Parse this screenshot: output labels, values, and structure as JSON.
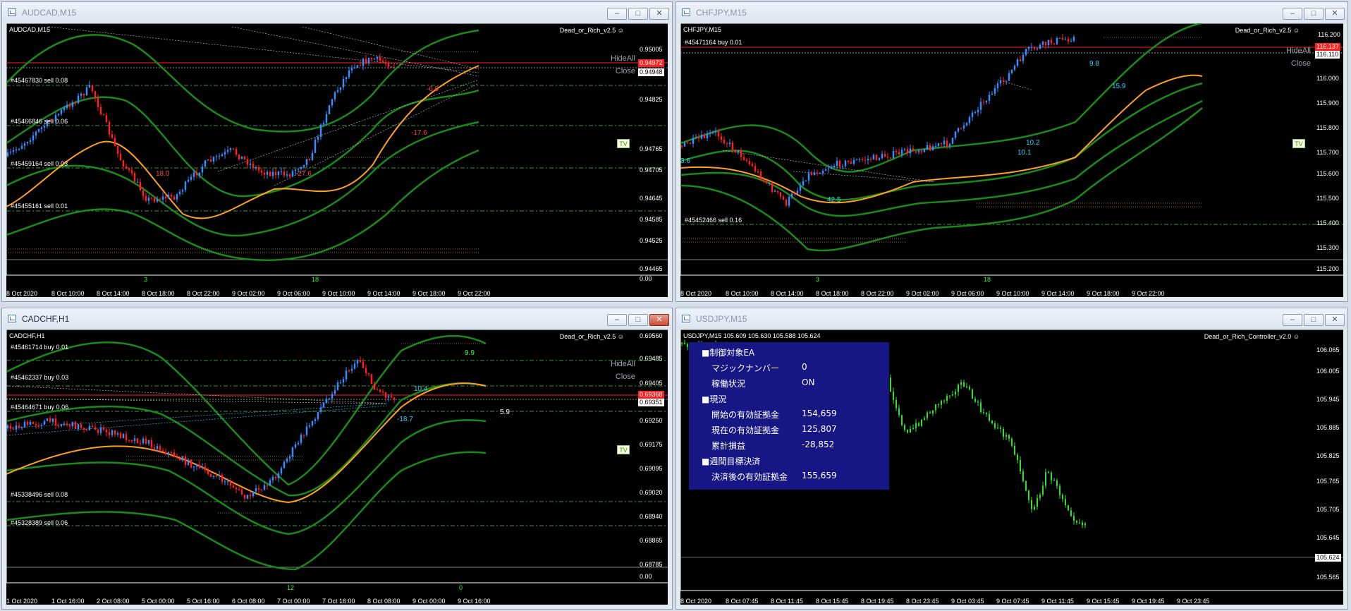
{
  "windows": {
    "w1": {
      "title": "AUDCAD,M15",
      "symbol": "AUDCAD,M15",
      "ea": "Dead_or_Rich_v2.5 ☺",
      "hideall": "HideAll",
      "close": "Close",
      "tv": "TV",
      "orders": [
        "#45467830 sell 0.08",
        "#45466846 sell 0.06",
        "#45459164 sell 0.03",
        "#45455161 sell 0.01"
      ],
      "price_ticks": [
        "0.95005",
        "0.94948",
        "0.94825",
        "0.94765",
        "0.94705",
        "0.94645",
        "0.94585",
        "0.94525",
        "0.94465",
        "0.00"
      ],
      "price_tag_red": "0.94972",
      "time_labels": [
        "8 Oct 2020",
        "8 Oct 10:00",
        "8 Oct 14:00",
        "8 Oct 18:00",
        "8 Oct 22:00",
        "9 Oct 02:00",
        "9 Oct 06:00",
        "9 Oct 10:00",
        "9 Oct 14:00",
        "9 Oct 18:00",
        "9 Oct 22:00"
      ],
      "sub_values": [
        "3",
        "18"
      ],
      "annotations": [
        "-6.9",
        "-17.6",
        "-27.6",
        "18.0"
      ]
    },
    "w2": {
      "title": "CHFJPY,M15",
      "symbol": "CHFJPY,M15",
      "ea": "Dead_or_Rich_v2.5 ☺",
      "hideall": "HideAll",
      "close": "Close",
      "tv": "TV",
      "orders": [
        "#45471164 buy 0.01",
        "#45452466 sell 0.16"
      ],
      "price_ticks": [
        "116.200",
        "116.110",
        "116.000",
        "115.900",
        "115.800",
        "115.700",
        "115.600",
        "115.500",
        "115.400",
        "115.300",
        "115.200"
      ],
      "price_tag_red": "116.137",
      "time_labels": [
        "8 Oct 2020",
        "8 Oct 10:00",
        "8 Oct 14:00",
        "8 Oct 18:00",
        "8 Oct 22:00",
        "9 Oct 02:00",
        "9 Oct 06:00",
        "9 Oct 10:00",
        "9 Oct 14:00",
        "9 Oct 18:00",
        "9 Oct 22:00"
      ],
      "sub_values": [
        "3",
        "18"
      ],
      "annotations": [
        "9.8",
        "15.9",
        "10.2",
        "10.1",
        "42.5",
        "3.6"
      ]
    },
    "w3": {
      "title": "CADCHF,H1",
      "symbol": "CADCHF,H1",
      "ea": "Dead_or_Rich_v2.5 ☺",
      "hideall": "HideAll",
      "close": "Close",
      "tv": "TV",
      "orders": [
        "#45461714 buy 0.01",
        "#45462337 buy 0.03",
        "#45464671 buy 0.06",
        "#45338496 sell 0.08",
        "#45328389 sell 0.06"
      ],
      "price_ticks": [
        "0.69560",
        "0.69485",
        "0.69405",
        "0.69351",
        "0.69250",
        "0.69175",
        "0.69095",
        "0.69020",
        "0.68940",
        "0.68865",
        "0.68785",
        "0.00"
      ],
      "price_tag_red": "0.69368",
      "time_labels": [
        "1 Oct 2020",
        "1 Oct 16:00",
        "2 Oct 08:00",
        "5 Oct 00:00",
        "5 Oct 16:00",
        "6 Oct 08:00",
        "7 Oct 00:00",
        "7 Oct 16:00",
        "8 Oct 08:00",
        "9 Oct 00:00",
        "9 Oct 16:00"
      ],
      "sub_values": [
        "12",
        "0"
      ],
      "annotations": [
        "9.9",
        "10.4",
        "-18.7",
        "5.9"
      ]
    },
    "w4": {
      "title": "USDJPY,M15",
      "symbol": "USDJPY,M15  105.609 105.630 105.588 105.624",
      "ea": "Dead_or_Rich_Controller_v2.0 ☺",
      "price_ticks": [
        "106.065",
        "106.005",
        "105.945",
        "105.885",
        "105.825",
        "105.765",
        "105.705",
        "105.645",
        "105.624",
        "105.565"
      ],
      "time_labels": [
        "8 Oct 2020",
        "8 Oct 07:45",
        "8 Oct 11:45",
        "8 Oct 15:45",
        "8 Oct 19:45",
        "8 Oct 23:45",
        "9 Oct 03:45",
        "9 Oct 07:45",
        "9 Oct 11:45",
        "9 Oct 15:45",
        "9 Oct 19:45",
        "9 Oct 23:45"
      ],
      "panel": {
        "h1": "■制御対象EA",
        "magic_label": "マジックナンバー",
        "magic_value": "0",
        "status_label": "稼働状況",
        "status_value": "ON",
        "h2": "■現況",
        "start_label": "開始の有効証拠金",
        "start_value": "154,659",
        "current_label": "現在の有効証拠金",
        "current_value": "125,807",
        "pl_label": "累計損益",
        "pl_value": "-28,852",
        "h3": "■週間目標決済",
        "after_label": "決済後の有効証拠金",
        "after_value": "155,659"
      }
    }
  }
}
